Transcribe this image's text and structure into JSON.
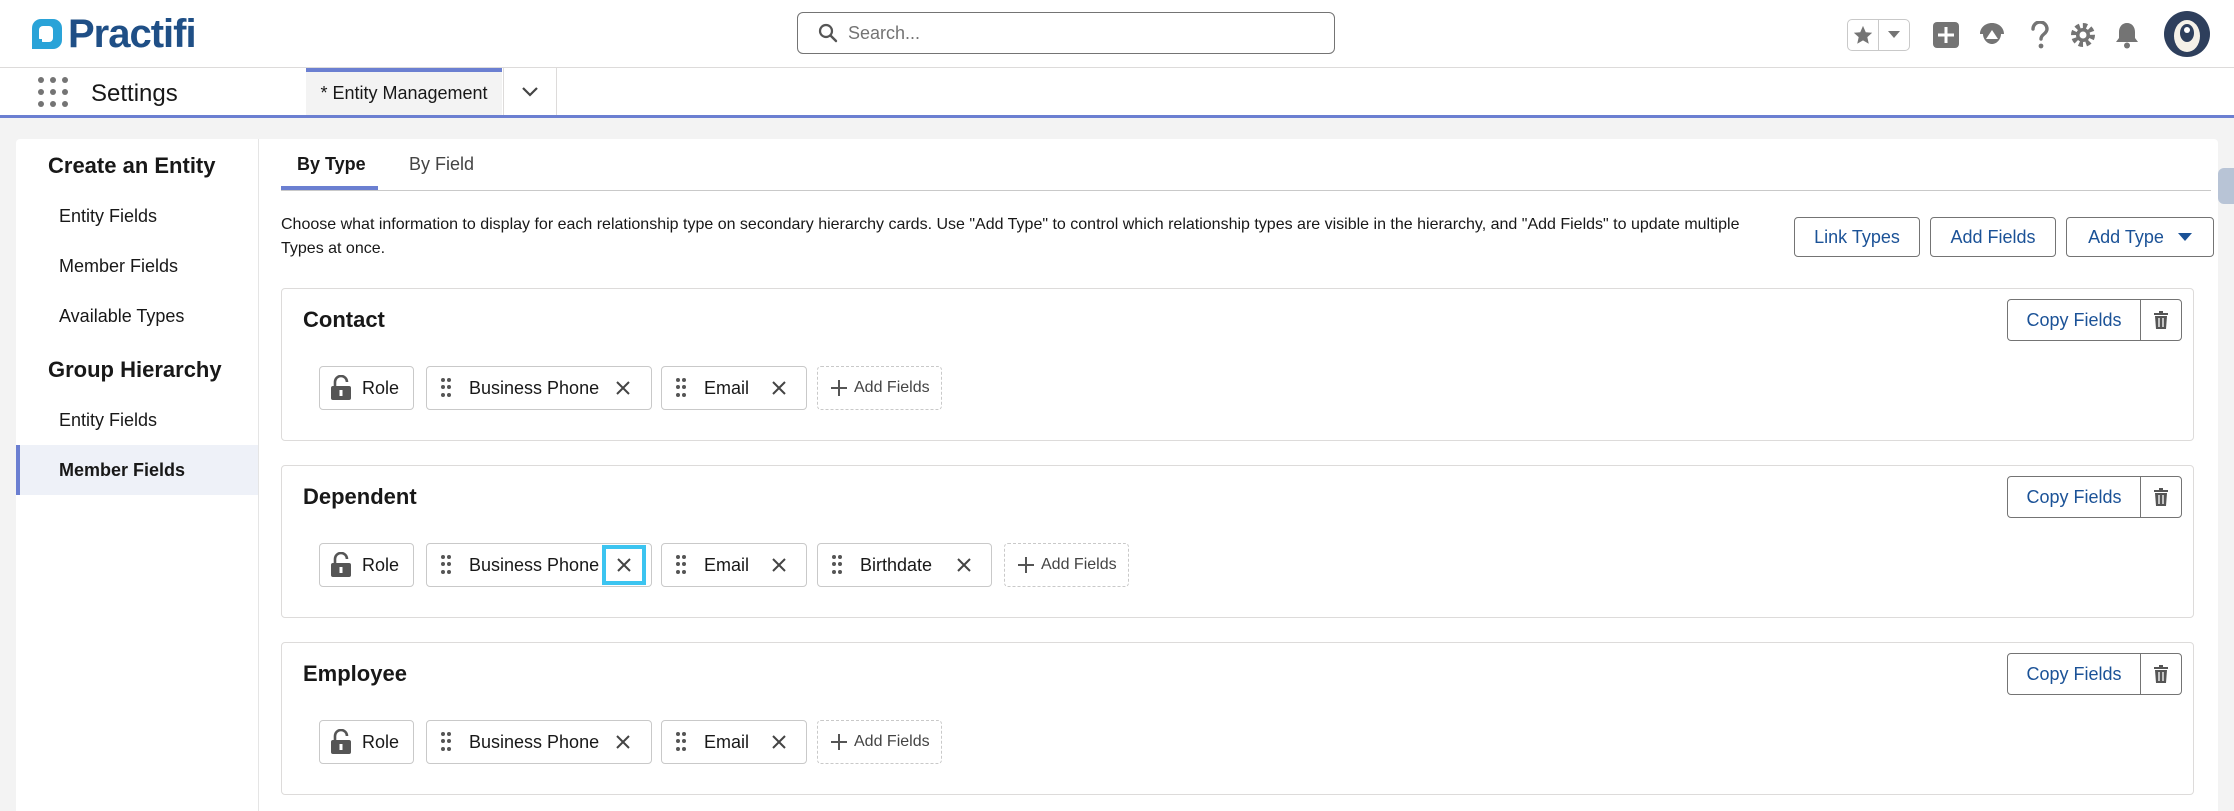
{
  "brand": {
    "name": "Practifi",
    "color": "#1f4f86"
  },
  "search": {
    "placeholder": "Search..."
  },
  "header_icons": [
    "favorites-star-icon",
    "favorites-dropdown-icon",
    "global-actions-plus-icon",
    "trailhead-icon",
    "help-icon",
    "setup-gear-icon",
    "notifications-bell-icon",
    "user-avatar"
  ],
  "nav": {
    "app_name": "Settings",
    "tab_label": "* Entity Management"
  },
  "sidebar": {
    "sections": [
      {
        "heading": "Create an Entity",
        "items": [
          "Entity Fields",
          "Member Fields",
          "Available Types"
        ]
      },
      {
        "heading": "Group Hierarchy",
        "items": [
          "Entity Fields",
          "Member Fields"
        ]
      }
    ],
    "active": "Group Hierarchy / Member Fields"
  },
  "content": {
    "tabs": [
      "By Type",
      "By Field"
    ],
    "active_tab": "By Type",
    "description": "Choose what information to display for each relationship type on secondary hierarchy cards. Use \"Add Type\" to control which relationship types are visible in the hierarchy, and \"Add Fields\" to update multiple Types at once.",
    "buttons": {
      "link_types": "Link Types",
      "add_fields": "Add Fields",
      "add_type": "Add Type"
    }
  },
  "cards": [
    {
      "title": "Contact",
      "copy_label": "Copy Fields",
      "locked_field": "Role",
      "fields": [
        "Business Phone",
        "Email"
      ],
      "add_label": "Add Fields"
    },
    {
      "title": "Dependent",
      "copy_label": "Copy Fields",
      "locked_field": "Role",
      "fields": [
        "Business Phone",
        "Email",
        "Birthdate"
      ],
      "add_label": "Add Fields"
    },
    {
      "title": "Employee",
      "copy_label": "Copy Fields",
      "locked_field": "Role",
      "fields": [
        "Business Phone",
        "Email"
      ],
      "add_label": "Add Fields"
    }
  ],
  "colors": {
    "accent": "#6b7fd1",
    "link": "#1b5297",
    "focus": "#3cc4f0"
  }
}
